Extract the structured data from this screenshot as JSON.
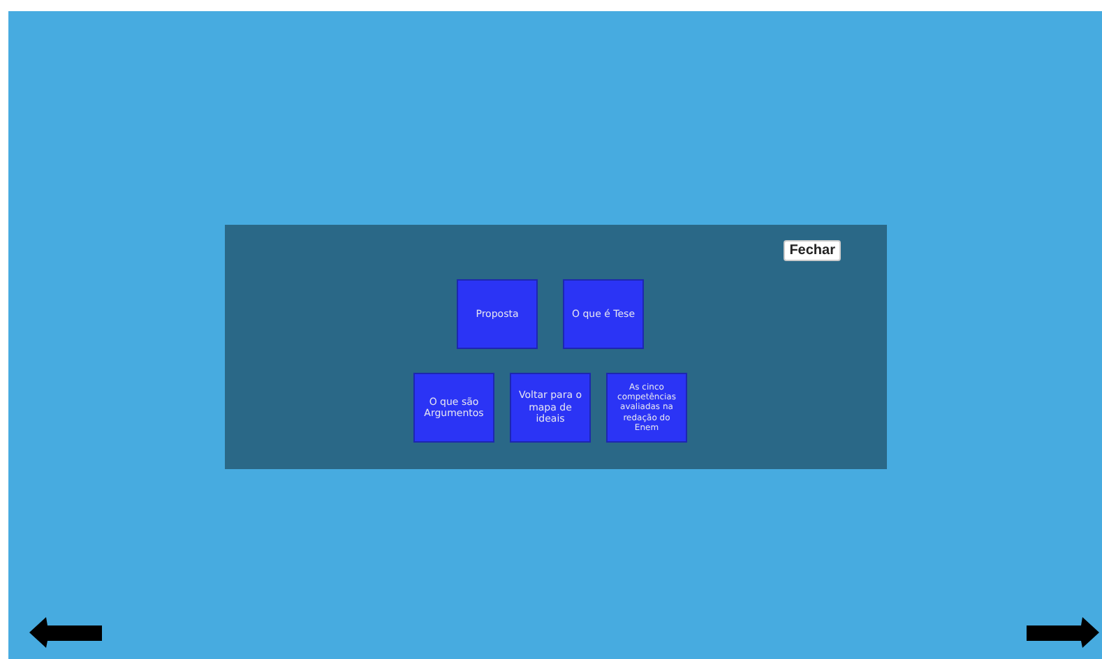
{
  "dialog": {
    "close_button": "Fechar",
    "button_rows": [
      [
        "Proposta",
        "O que é Tese"
      ],
      [
        "O que são Argumentos",
        "Voltar para o mapa de ideais",
        "As cinco competências avaliadas na redação do Enem"
      ]
    ]
  },
  "navigation": [
    {
      "kind": "back"
    },
    {
      "kind": "forward"
    }
  ]
}
